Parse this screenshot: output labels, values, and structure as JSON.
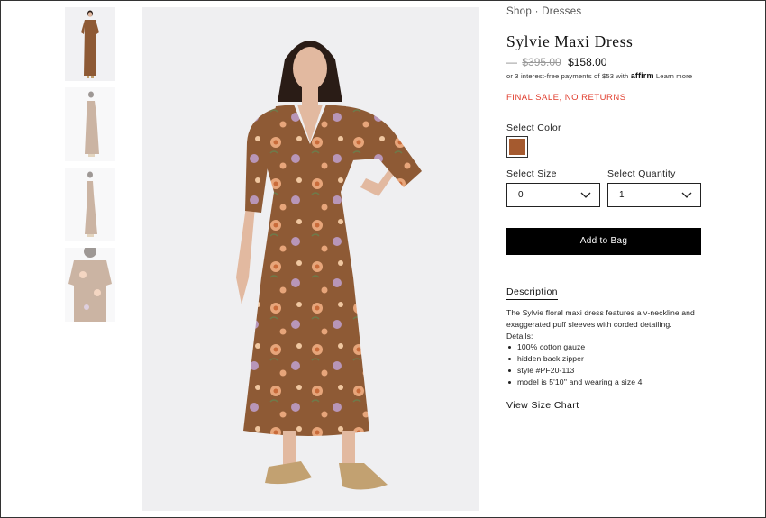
{
  "breadcrumb": {
    "shop": "Shop",
    "separator": "·",
    "category": "Dresses"
  },
  "product": {
    "title": "Sylvie Maxi Dress",
    "dash": "—",
    "original_price": "$395.00",
    "sale_price": "$158.00",
    "affirm_text": "or 3 interest-free payments of $53 with",
    "affirm_brand": "affirm",
    "affirm_link": "Learn more",
    "final_sale": "FINAL SALE, NO RETURNS",
    "color_label": "Select Color",
    "color_swatch": "#a55a2f",
    "size_label": "Select Size",
    "size_value": "0",
    "quantity_label": "Select Quantity",
    "quantity_value": "1",
    "add_to_bag": "Add to Bag"
  },
  "description": {
    "heading": "Description",
    "text": "The Sylvie floral maxi dress features a v-neckline and exaggerated puff sleeves with corded detailing.",
    "details_label": "Details:",
    "details": [
      "100% cotton gauze",
      "hidden back zipper",
      "style #PF20-113",
      "model is 5'10'' and wearing a size 4"
    ],
    "size_chart": "View Size Chart"
  },
  "colors": {
    "dress": "#8e5a35",
    "skin": "#e2b9a0",
    "hair": "#2a1c16",
    "sandal": "#c2a171"
  }
}
